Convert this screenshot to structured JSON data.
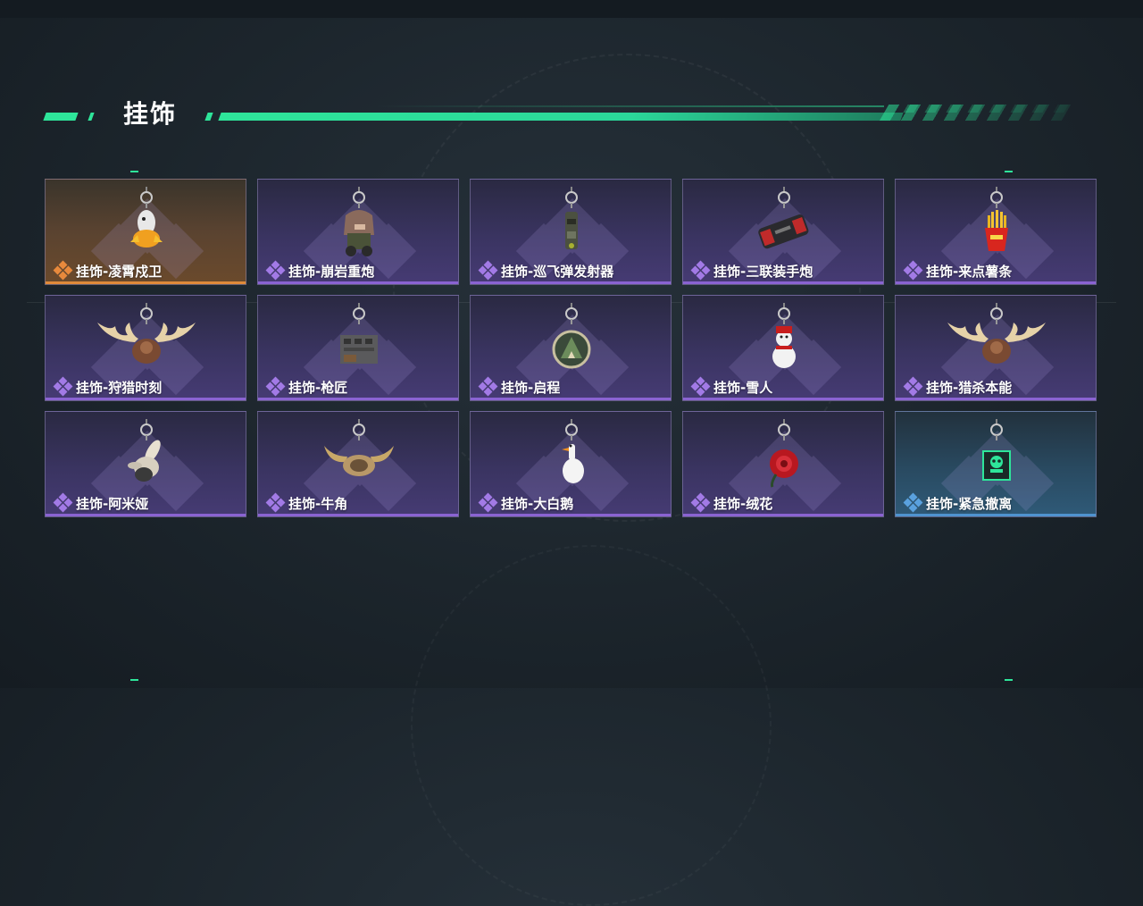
{
  "section": {
    "title": "挂饰"
  },
  "colors": {
    "accent": "#2ee59a",
    "epic": "#8a63d2",
    "legendary": "#e08a3a",
    "rare": "#4f93cf"
  },
  "items": [
    {
      "label": "挂饰-凌霄戍卫",
      "rarity": "legendary",
      "charm": "chick-icon"
    },
    {
      "label": "挂饰-崩岩重炮",
      "rarity": "epic",
      "charm": "figure-icon"
    },
    {
      "label": "挂饰-巡飞弹发射器",
      "rarity": "epic",
      "charm": "launcher-icon"
    },
    {
      "label": "挂饰-三联装手炮",
      "rarity": "epic",
      "charm": "handcannon-icon"
    },
    {
      "label": "挂饰-来点薯条",
      "rarity": "epic",
      "charm": "fries-icon"
    },
    {
      "label": "挂饰-狩猎时刻",
      "rarity": "epic",
      "charm": "antlers-icon"
    },
    {
      "label": "挂饰-枪匠",
      "rarity": "epic",
      "charm": "workbench-icon"
    },
    {
      "label": "挂饰-启程",
      "rarity": "epic",
      "charm": "medallion-icon"
    },
    {
      "label": "挂饰-雪人",
      "rarity": "epic",
      "charm": "snowman-icon"
    },
    {
      "label": "挂饰-猎杀本能",
      "rarity": "epic",
      "charm": "antlers-icon"
    },
    {
      "label": "挂饰-阿米娅",
      "rarity": "epic",
      "charm": "bunny-icon"
    },
    {
      "label": "挂饰-牛角",
      "rarity": "epic",
      "charm": "bull-horns-icon"
    },
    {
      "label": "挂饰-大白鹅",
      "rarity": "epic",
      "charm": "goose-icon"
    },
    {
      "label": "挂饰-绒花",
      "rarity": "epic",
      "charm": "rose-icon"
    },
    {
      "label": "挂饰-紧急撤离",
      "rarity": "rare",
      "charm": "skull-box-icon"
    }
  ]
}
